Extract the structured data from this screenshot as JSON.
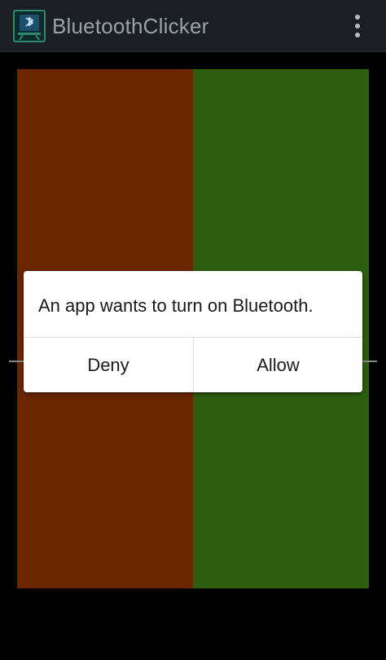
{
  "app": {
    "title": "BluetoothClicker",
    "icon": "bluetooth-clicker-app-icon",
    "menu_icon": "overflow-menu-icon"
  },
  "colors": {
    "action_bar": "#1b1f24",
    "title_text": "#9aa2a9",
    "left_panel": "#6b2600",
    "right_panel": "#2d5e10",
    "background": "#000000",
    "dialog_bg": "#ffffff"
  },
  "dialog": {
    "message": "An app wants to turn on Bluetooth.",
    "deny_label": "Deny",
    "allow_label": "Allow"
  }
}
